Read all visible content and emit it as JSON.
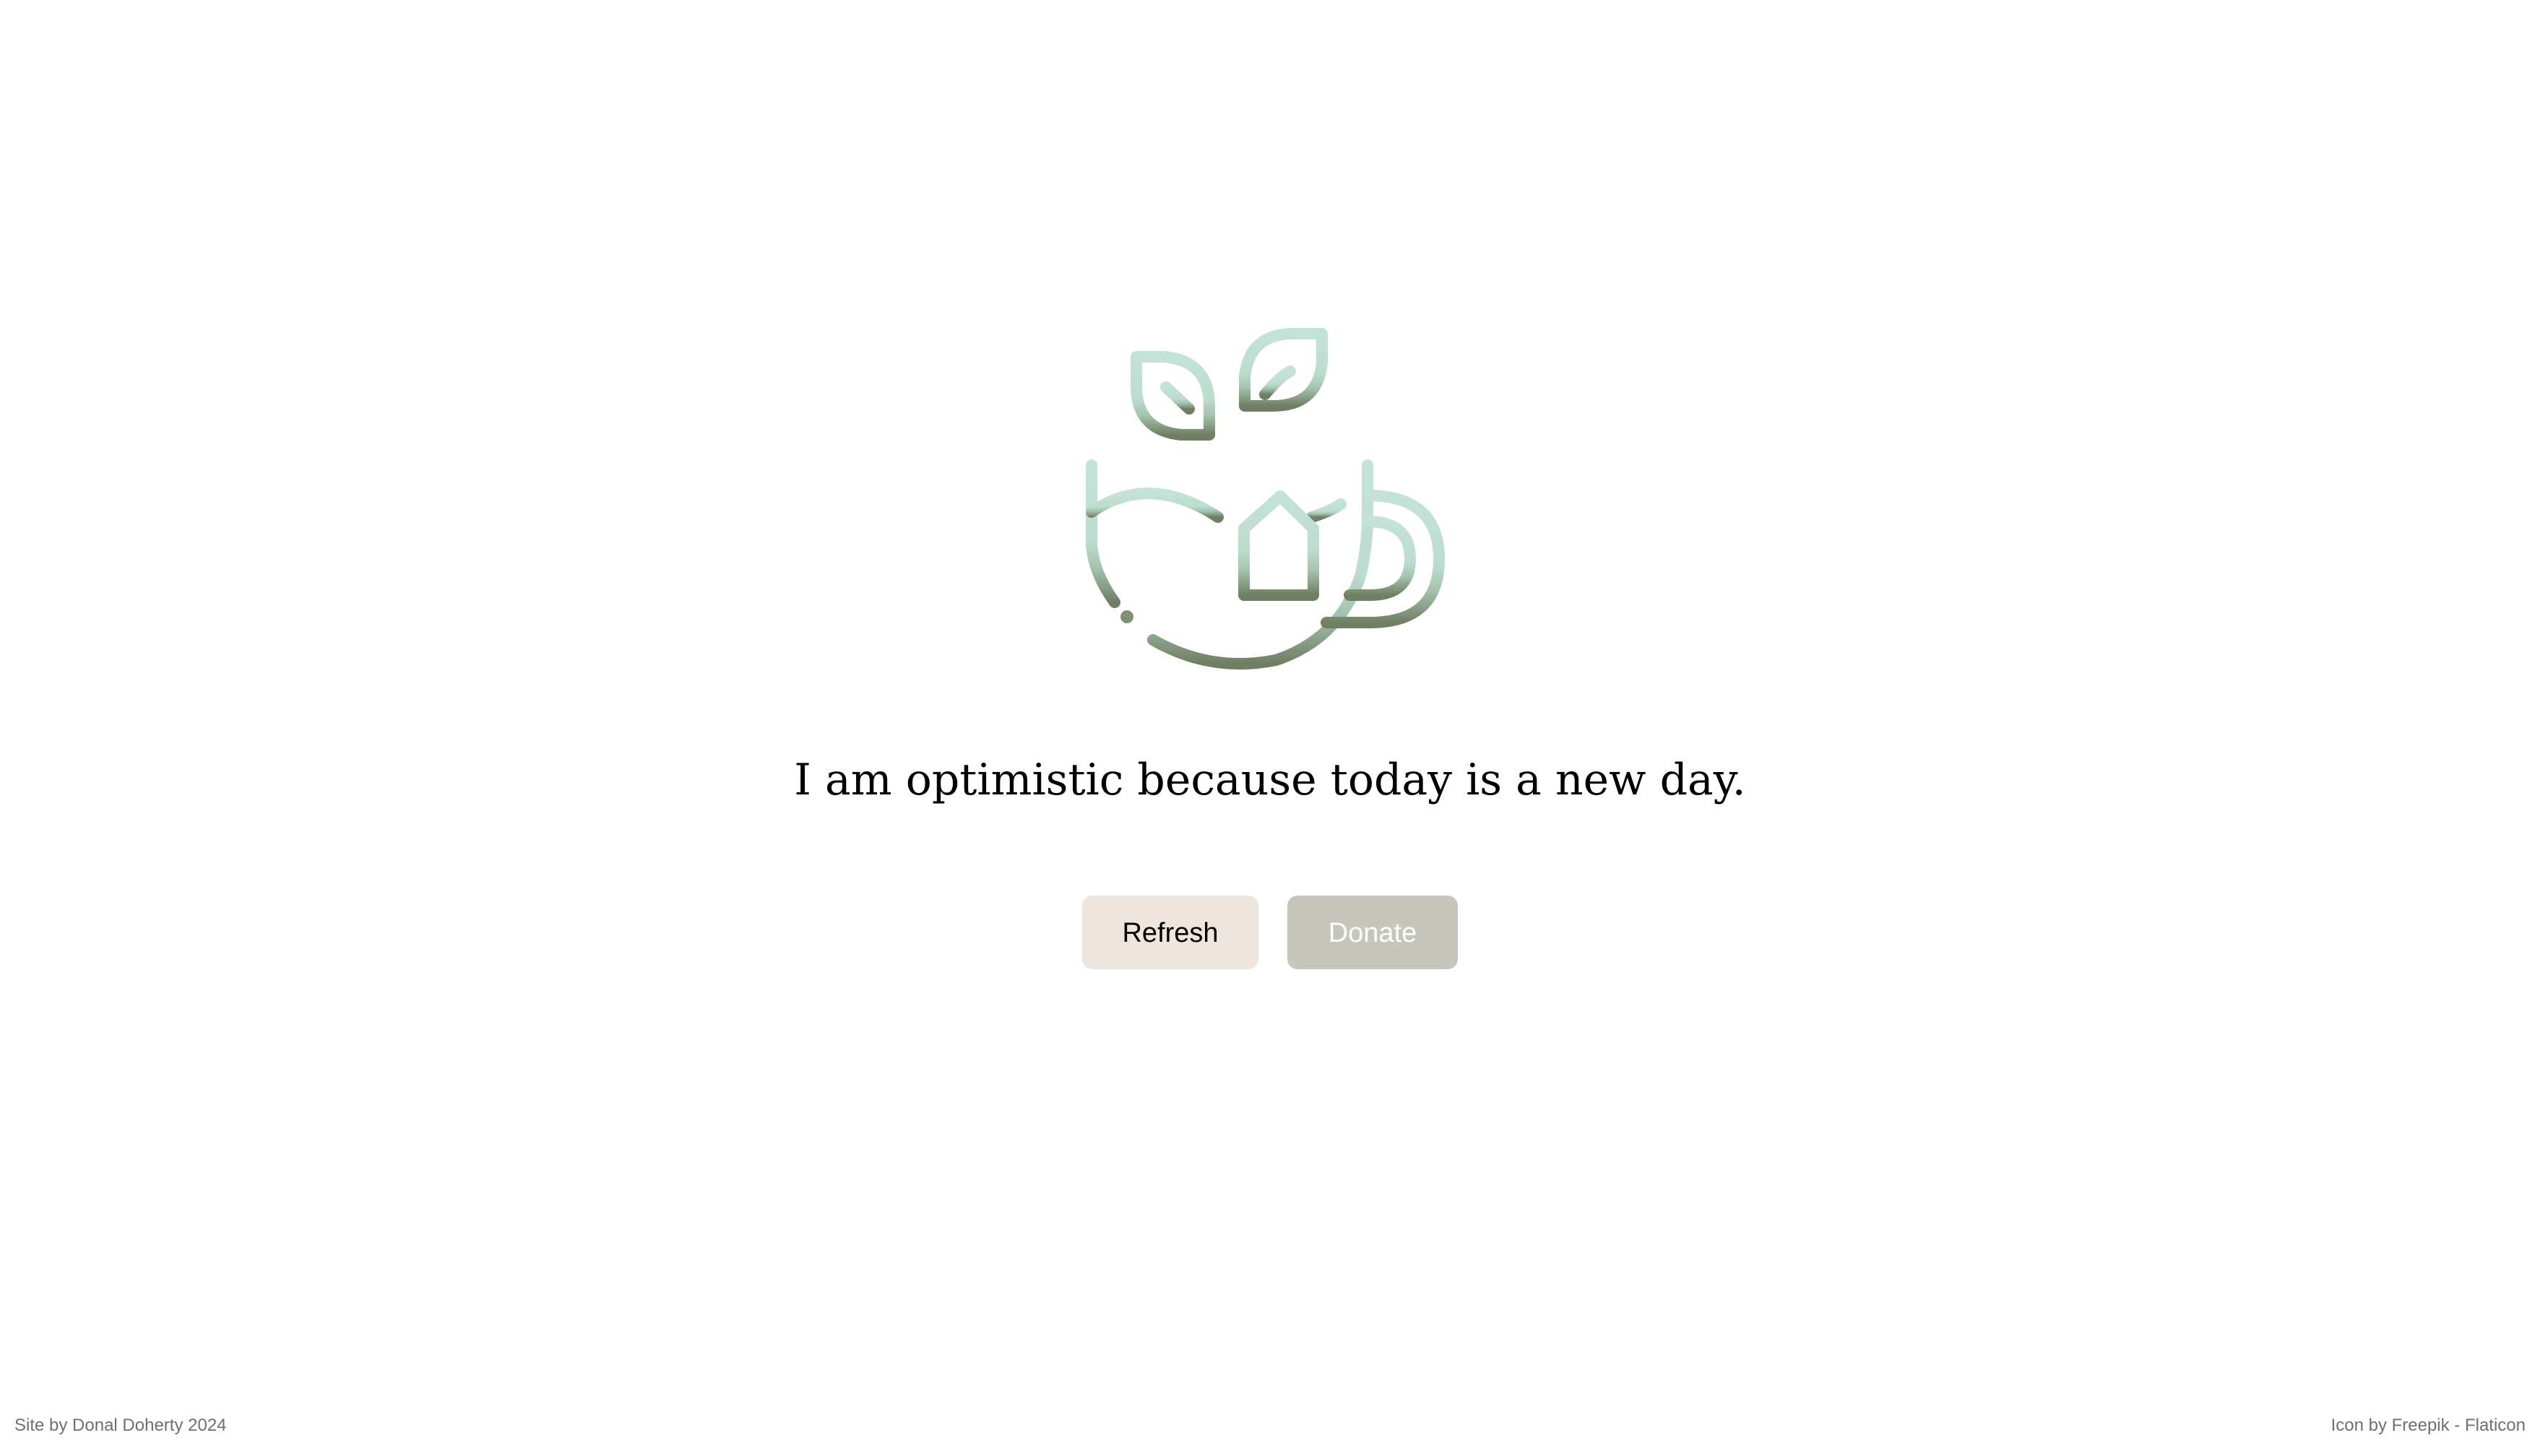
{
  "icon": {
    "name": "tea-cup-icon",
    "gradient_top": "#c3e3d8",
    "gradient_mid": "#a5c3ad",
    "gradient_bottom": "#6f7f63"
  },
  "quote": {
    "text": "I am optimistic because today is a new day."
  },
  "buttons": {
    "refresh_label": "Refresh",
    "donate_label": "Donate",
    "refresh_color": "#efe5df",
    "donate_color": "#c6c6bd"
  },
  "footer": {
    "left_text": "Site by Donal Doherty 2024",
    "right_text": "Icon by Freepik - Flaticon"
  }
}
